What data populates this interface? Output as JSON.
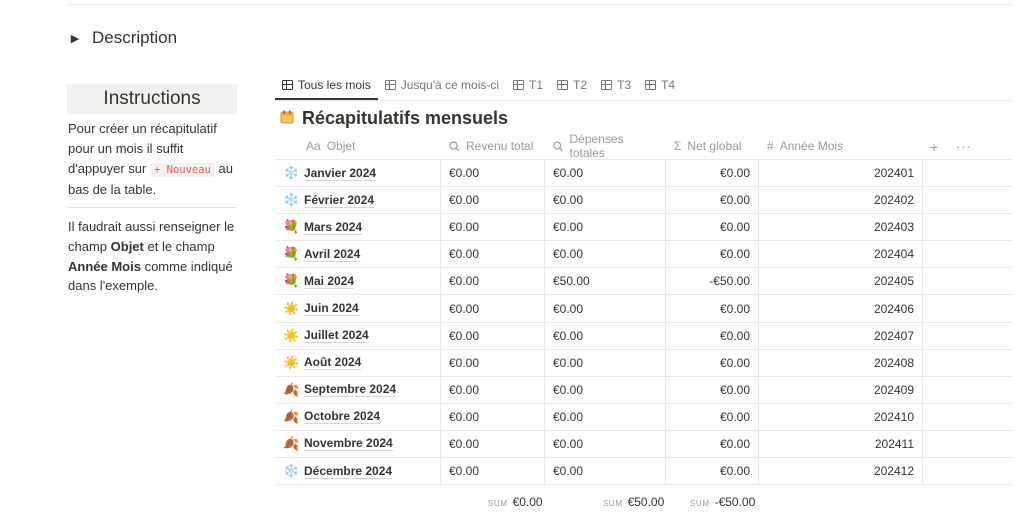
{
  "toggle": {
    "label": "Description"
  },
  "instructions": {
    "title": "Instructions",
    "p1_before": "Pour créer un récapitulatif pour un mois il suffit d'appuyer sur ",
    "p1_chip": "+ Nouveau",
    "p1_after": " au bas de la table.",
    "p2_a": "Il faudrait aussi renseigner le champ ",
    "p2_b": "Objet",
    "p2_c": " et le champ ",
    "p2_d": "Année Mois",
    "p2_e": " comme indiqué dans l'exemple."
  },
  "tabs": [
    {
      "label": "Tous les mois"
    },
    {
      "label": "Jusqu'à ce mois-ci"
    },
    {
      "label": "T1"
    },
    {
      "label": "T2"
    },
    {
      "label": "T3"
    },
    {
      "label": "T4"
    }
  ],
  "database": {
    "title": "Récapitulatifs mensuels",
    "icon": "calendar-icon"
  },
  "columns": {
    "objet": {
      "icon": "Aa",
      "label": "Objet"
    },
    "revenu": {
      "icon": "search-icon",
      "label": "Revenu total"
    },
    "depenses": {
      "icon": "search-icon",
      "label": "Dépenses totales"
    },
    "net": {
      "icon": "Σ",
      "label": "Net global"
    },
    "annee": {
      "icon": "#",
      "label": "Année Mois"
    }
  },
  "header_actions": {
    "add": "+",
    "more": "···"
  },
  "rows": [
    {
      "emoji": "❄️",
      "name": "Janvier 2024",
      "rev": "€0.00",
      "dep": "€0.00",
      "net": "€0.00",
      "ym": "202401"
    },
    {
      "emoji": "❄️",
      "name": "Février 2024",
      "rev": "€0.00",
      "dep": "€0.00",
      "net": "€0.00",
      "ym": "202402"
    },
    {
      "emoji": "💐",
      "name": "Mars 2024",
      "rev": "€0.00",
      "dep": "€0.00",
      "net": "€0.00",
      "ym": "202403"
    },
    {
      "emoji": "💐",
      "name": "Avril 2024",
      "rev": "€0.00",
      "dep": "€0.00",
      "net": "€0.00",
      "ym": "202404"
    },
    {
      "emoji": "💐",
      "name": "Mai 2024",
      "rev": "€0.00",
      "dep": "€50.00",
      "net": "-€50.00",
      "ym": "202405"
    },
    {
      "emoji": "☀️",
      "name": "Juin 2024",
      "rev": "€0.00",
      "dep": "€0.00",
      "net": "€0.00",
      "ym": "202406"
    },
    {
      "emoji": "☀️",
      "name": "Juillet 2024",
      "rev": "€0.00",
      "dep": "€0.00",
      "net": "€0.00",
      "ym": "202407"
    },
    {
      "emoji": "☀️",
      "name": "Août 2024",
      "rev": "€0.00",
      "dep": "€0.00",
      "net": "€0.00",
      "ym": "202408"
    },
    {
      "emoji": "🍂",
      "name": "Septembre 2024",
      "rev": "€0.00",
      "dep": "€0.00",
      "net": "€0.00",
      "ym": "202409"
    },
    {
      "emoji": "🍂",
      "name": "Octobre 2024",
      "rev": "€0.00",
      "dep": "€0.00",
      "net": "€0.00",
      "ym": "202410"
    },
    {
      "emoji": "🍂",
      "name": "Novembre 2024",
      "rev": "€0.00",
      "dep": "€0.00",
      "net": "€0.00",
      "ym": "202411"
    },
    {
      "emoji": "❄️",
      "name": "Décembre 2024",
      "rev": "€0.00",
      "dep": "€0.00",
      "net": "€0.00",
      "ym": "202412"
    }
  ],
  "sums": {
    "label": "SUM",
    "revenu": "€0.00",
    "depenses": "€50.00",
    "net": "-€50.00"
  }
}
